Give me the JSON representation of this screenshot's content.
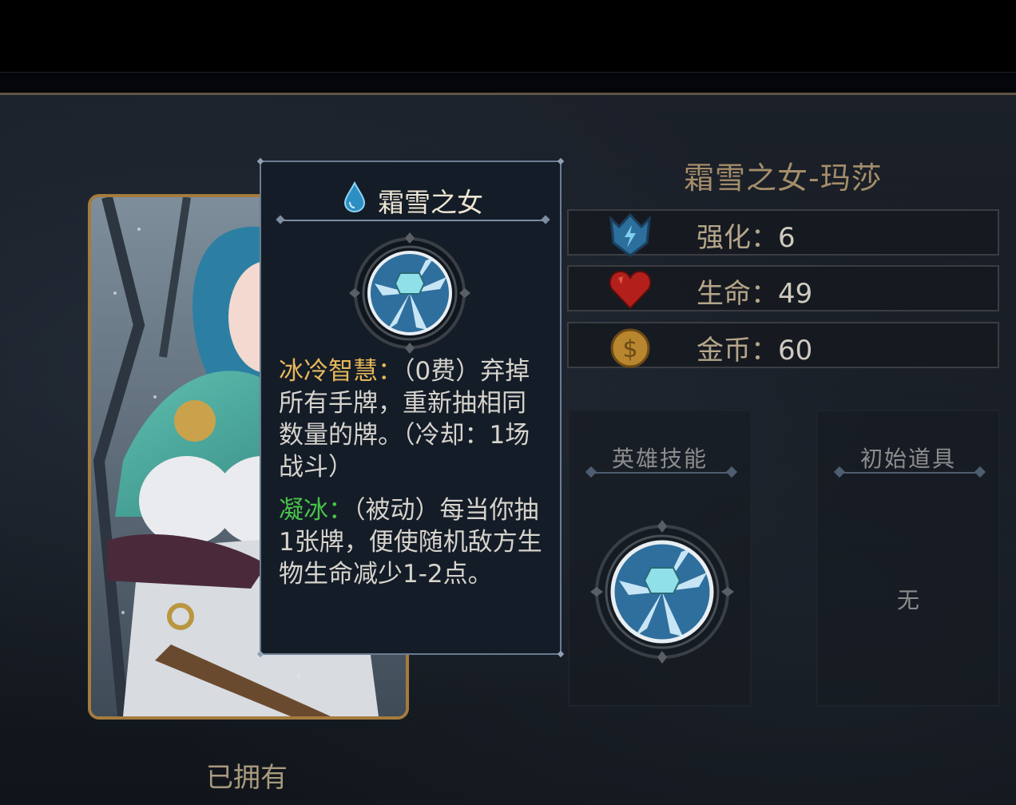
{
  "hero": {
    "name": "霜雪之女-玛莎",
    "stats": [
      {
        "label": "强化：",
        "value": "6",
        "icon": "shield-emblem-icon"
      },
      {
        "label": "生命：",
        "value": "49",
        "icon": "heart-icon"
      },
      {
        "label": "金币：",
        "value": "60",
        "icon": "gold-coin-icon"
      }
    ],
    "owned_label": "已拥有"
  },
  "skill_box": {
    "title": "英雄技能"
  },
  "item_box": {
    "title": "初始道具",
    "empty_text": "无"
  },
  "tooltip": {
    "title": "霜雪之女",
    "ability1": {
      "name": "冰冷智慧：",
      "desc": "（0费）弃掉所有手牌，重新抽相同数量的牌。（冷却：1场战斗）"
    },
    "ability2": {
      "name": "凝冰：",
      "desc": "（被动）每当你抽1张牌，便使随机敌方生物生命减少1-2点。"
    }
  },
  "colors": {
    "gold_text": "#e5b75a",
    "green_text": "#48c24a",
    "card_border": "#a57b3e"
  }
}
